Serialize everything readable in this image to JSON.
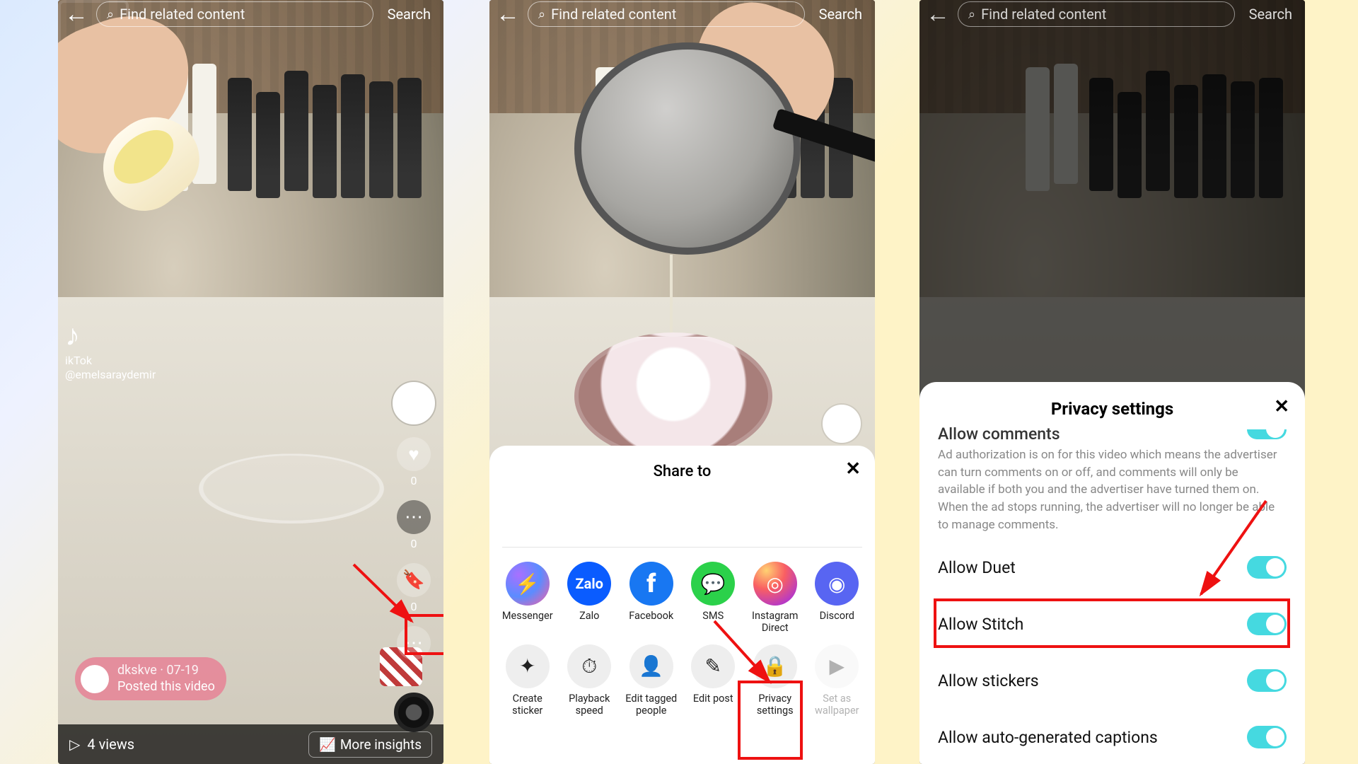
{
  "search": {
    "placeholder": "Find related content",
    "button": "Search"
  },
  "panel1": {
    "watermark_handle": "@emelsaraydemir",
    "watermark_app": "ikTok",
    "rail": {
      "like_count": "0",
      "comment_count": "0",
      "bookmark_count": "0"
    },
    "post_pill": {
      "user": "dkskve",
      "date": "07-19",
      "text": "Posted this video"
    },
    "views": "4 views",
    "insights": "More insights"
  },
  "panel2": {
    "sheet_title": "Share to",
    "share_row": [
      {
        "label": "Messenger"
      },
      {
        "label": "Zalo"
      },
      {
        "label": "Facebook"
      },
      {
        "label": "SMS"
      },
      {
        "label": "Instagram Direct"
      },
      {
        "label": "Discord"
      }
    ],
    "action_row": [
      {
        "label": "Create sticker"
      },
      {
        "label": "Playback speed"
      },
      {
        "label": "Edit tagged people"
      },
      {
        "label": "Edit post"
      },
      {
        "label": "Privacy settings"
      },
      {
        "label": "Set as wallpaper"
      }
    ]
  },
  "panel3": {
    "sheet_title": "Privacy settings",
    "partial_row": "Allow comments",
    "desc": "Ad authorization is on for this video which means the advertiser can turn comments on or off, and comments will only be available if both you and the advertiser have turned them on. When the ad stops running, the advertiser will no longer be able to manage comments.",
    "rows": [
      {
        "label": "Allow Duet",
        "on": true
      },
      {
        "label": "Allow Stitch",
        "on": true
      },
      {
        "label": "Allow stickers",
        "on": true
      },
      {
        "label": "Allow auto-generated captions",
        "on": true
      }
    ]
  }
}
